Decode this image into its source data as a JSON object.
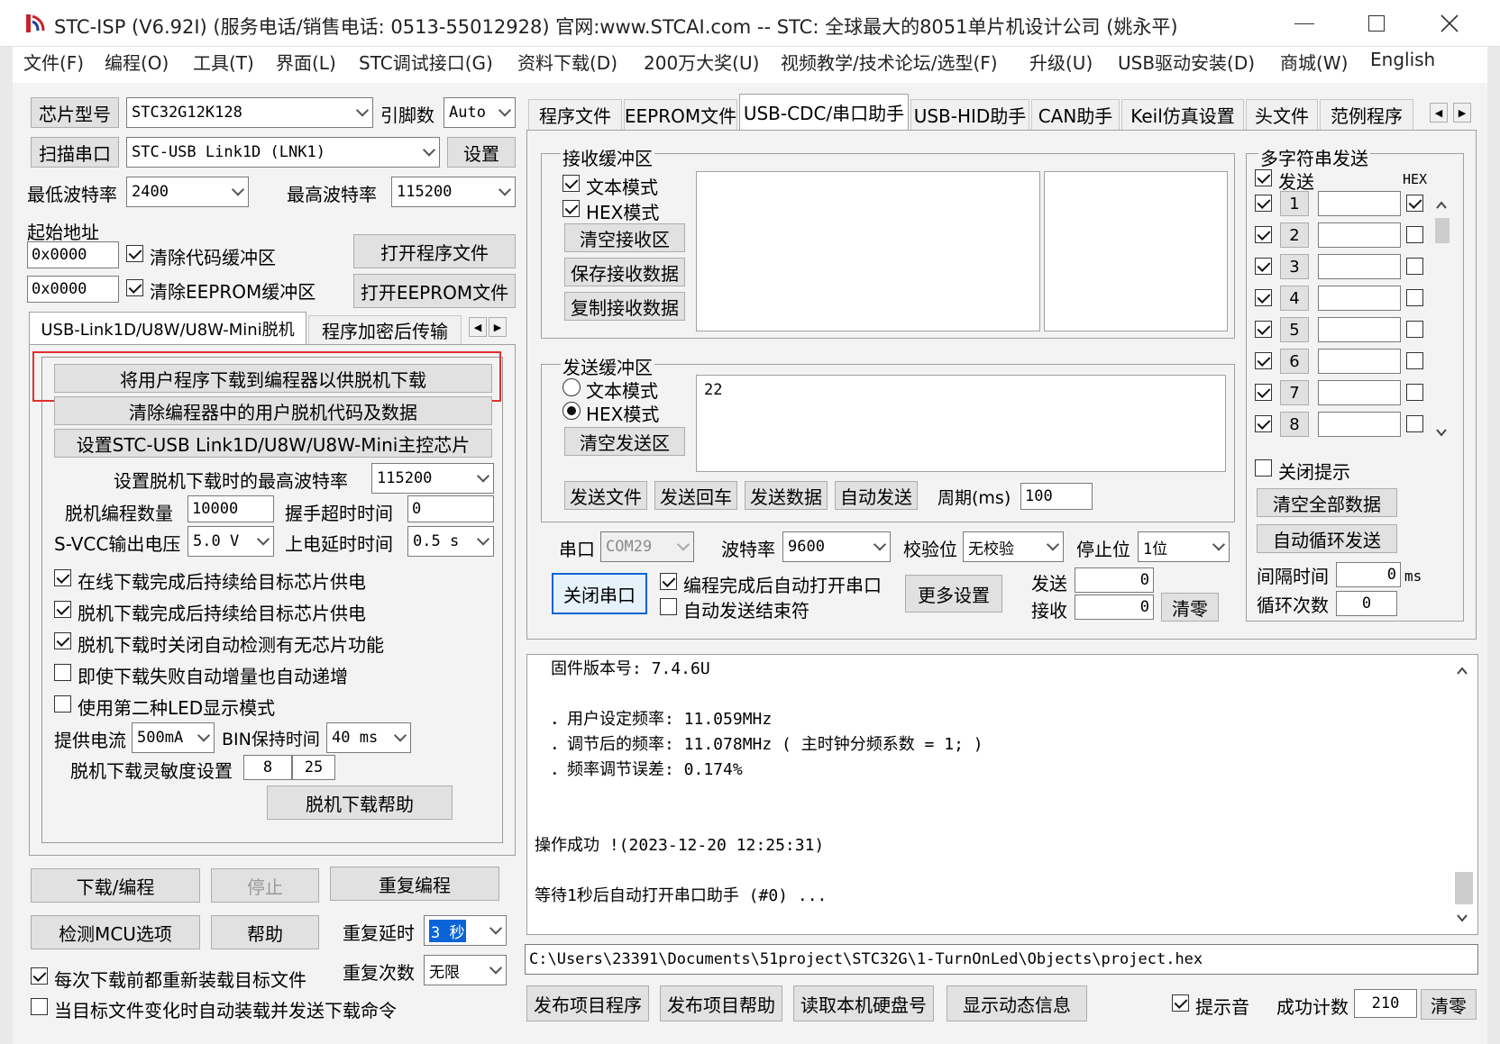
{
  "window": {
    "title": "STC-ISP (V6.92I) (服务电话/销售电话: 0513-55012928) 官网:www.STCAI.com  -- STC: 全球最大的8051单片机设计公司 (姚永平)"
  },
  "menu": [
    "文件(F)",
    "编程(O)",
    "工具(T)",
    "界面(L)",
    "STC调试接口(G)",
    "资料下载(D)",
    "200万大奖(U)",
    "视频教学/技术论坛/选型(F)",
    "升级(U)",
    "USB驱动安装(D)",
    "商城(W)",
    "English"
  ],
  "left": {
    "chip_type_btn": "芯片型号",
    "chip_type": "STC32G12K128",
    "pins_label": "引脚数",
    "pins": "Auto",
    "scan_btn": "扫描串口",
    "port": "STC-USB Link1D (LNK1)",
    "settings_btn": "设置",
    "min_baud_label": "最低波特率",
    "min_baud": "2400",
    "max_baud_label": "最高波特率",
    "max_baud": "115200",
    "start_addr_label": "起始地址",
    "addr1": "0x0000",
    "clear_code": "清除代码缓冲区",
    "open_prog": "打开程序文件",
    "addr2": "0x0000",
    "clear_eeprom": "清除EEPROM缓冲区",
    "open_eeprom": "打开EEPROM文件",
    "tabs": [
      "USB-Link1D/U8W/U8W-Mini脱机",
      "程序加密后传输"
    ],
    "offline": {
      "btn_download": "将用户程序下载到编程器以供脱机下载",
      "btn_clear": "清除编程器中的用户脱机代码及数据",
      "btn_set_chip": "设置STC-USB Link1D/U8W/U8W-Mini主控芯片",
      "max_baud_label": "设置脱机下载时的最高波特率",
      "max_baud": "115200",
      "count_label": "脱机编程数量",
      "count": "10000",
      "handshake_label": "握手超时时间",
      "handshake": "0",
      "svcc_label": "S-VCC输出电压",
      "svcc": "5.0 V",
      "power_delay_label": "上电延时时间",
      "power_delay": "0.5 s",
      "cb1": "在线下载完成后持续给目标芯片供电",
      "cb2": "脱机下载完成后持续给目标芯片供电",
      "cb3": "脱机下载时关闭自动检测有无芯片功能",
      "cb4": "即使下载失败自动增量也自动递增",
      "cb5": "使用第二种LED显示模式",
      "current_label": "提供电流",
      "current": "500mA",
      "bin_label": "BIN保持时间",
      "bin": "40 ms",
      "sens_label": "脱机下载灵敏度设置",
      "sens1": "8",
      "sens2": "25",
      "help_btn": "脱机下载帮助"
    },
    "btn_download": "下载/编程",
    "btn_stop": "停止",
    "btn_reprog": "重复编程",
    "btn_check": "检测MCU选项",
    "btn_help": "帮助",
    "repeat_delay_label": "重复延时",
    "repeat_delay": "3 秒",
    "repeat_count_label": "重复次数",
    "repeat_count": "无限",
    "reload": "每次下载前都重新装载目标文件",
    "auto_send": "当目标文件变化时自动装载并发送下载命令"
  },
  "right": {
    "tabs": [
      "程序文件",
      "EEPROM文件",
      "USB-CDC/串口助手",
      "USB-HID助手",
      "CAN助手",
      "Keil仿真设置",
      "头文件",
      "范例程序"
    ],
    "recv_group": "接收缓冲区",
    "recv_text": "文本模式",
    "recv_hex": "HEX模式",
    "recv_clear": "清空接收区",
    "recv_save": "保存接收数据",
    "recv_copy": "复制接收数据",
    "send_group": "发送缓冲区",
    "send_text": "文本模式",
    "send_hex": "HEX模式",
    "send_clear": "清空发送区",
    "send_content": "22",
    "send_file": "发送文件",
    "send_cr": "发送回车",
    "send_data": "发送数据",
    "auto_send": "自动发送",
    "period_label": "周期(ms)",
    "period": "100",
    "multi_group": "多字符串发送",
    "multi_send": "发送",
    "multi_hex": "HEX",
    "multi_rows": [
      "1",
      "2",
      "3",
      "4",
      "5",
      "6",
      "7",
      "8"
    ],
    "close_tip": "关闭提示",
    "clear_all": "清空全部数据",
    "auto_loop": "自动循环发送",
    "interval_label": "间隔时间",
    "interval": "0",
    "interval_unit": "ms",
    "loop_label": "循环次数",
    "loop": "0",
    "port_label": "串口",
    "port": "COM29",
    "baud_label": "波特率",
    "baud": "9600",
    "parity_label": "校验位",
    "parity": "无校验",
    "stop_label": "停止位",
    "stop": "1位",
    "close_port": "关闭串口",
    "auto_open": "编程完成后自动打开串口",
    "auto_end": "自动发送结束符",
    "more_settings": "更多设置",
    "tx_label": "发送",
    "tx": "0",
    "rx_label": "接收",
    "rx": "0",
    "clear_counts": "清零"
  },
  "log": {
    "lines": [
      "固件版本号: 7.4.6U",
      "",
      "．用户设定频率: 11.059MHz",
      "．调节后的频率: 11.078MHz ( 主时钟分频系数 = 1; )",
      "．频率调节误差: 0.174%",
      "",
      "",
      "操作成功 !(2023-12-20 12:25:31)",
      "",
      "等待1秒后自动打开串口助手 (#0) ..."
    ]
  },
  "path": "C:\\Users\\23391\\Documents\\51project\\STC32G\\1-TurnOnLed\\Objects\\project.hex",
  "bottom": {
    "publish": "发布项目程序",
    "publish_help": "发布项目帮助",
    "read_disk": "读取本机硬盘号",
    "show_info": "显示动态信息",
    "sound": "提示音",
    "success_label": "成功计数",
    "success": "210",
    "clear": "清零"
  }
}
